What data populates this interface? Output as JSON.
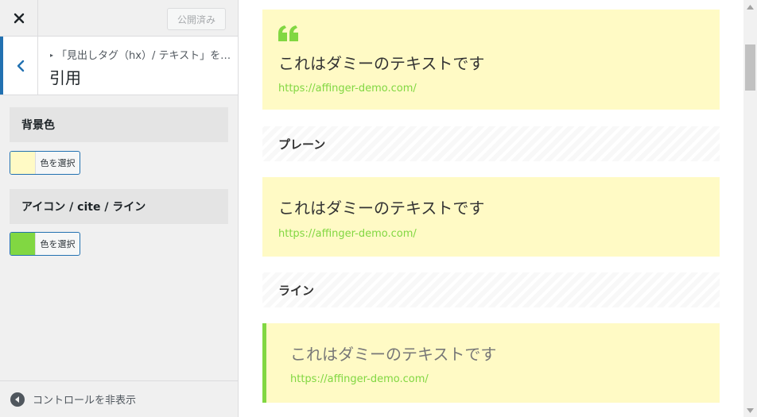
{
  "topbar": {
    "publish_label": "公開済み"
  },
  "section": {
    "breadcrumb": "「見出しタグ（hx）/ テキスト」を…",
    "title": "引用"
  },
  "controls": [
    {
      "label": "背景色",
      "button_label": "色を選択",
      "color": "#fffac5"
    },
    {
      "label": "アイコン / cite / ライン",
      "button_label": "色を選択",
      "color": "#81d742"
    }
  ],
  "footer": {
    "hide_controls_label": "コントロールを非表示"
  },
  "preview": {
    "box1": {
      "text": "これはダミーのテキストです",
      "cite": "https://affinger-demo.com/"
    },
    "heading_plain": "プレーン",
    "box2": {
      "text": "これはダミーのテキストです",
      "cite": "https://affinger-demo.com/"
    },
    "heading_line": "ライン",
    "box3": {
      "text": "これはダミーのテキストです",
      "cite": "https://affinger-demo.com/"
    }
  },
  "colors": {
    "accent": "#2271b1",
    "quote_bg": "#fffac5",
    "quote_line": "#81d742"
  },
  "icons": [
    "close-icon",
    "chevron-left-icon",
    "quote-icon",
    "hide-controls-icon",
    "arrow-up-icon",
    "arrow-down-icon"
  ]
}
